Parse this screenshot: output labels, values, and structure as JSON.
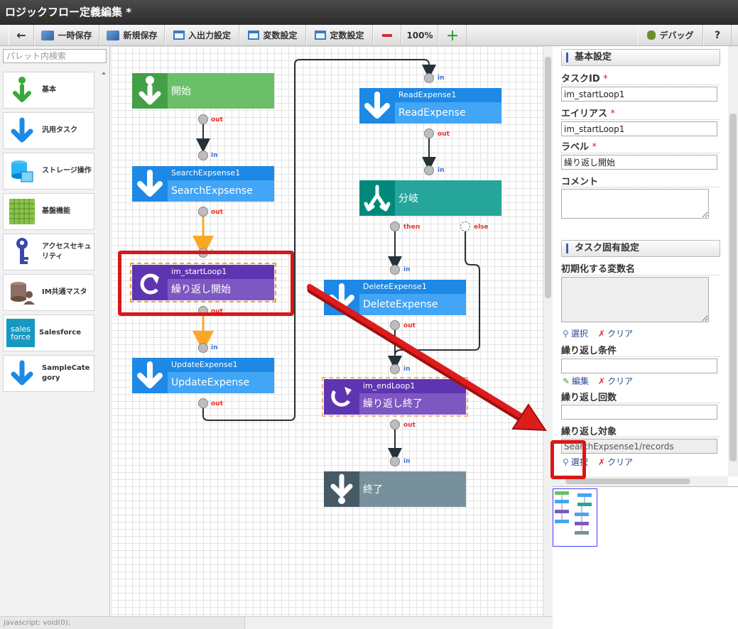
{
  "window": {
    "title": "ロジックフロー定義編集 *"
  },
  "toolbar": {
    "back_label": "←",
    "temp_save_label": "一時保存",
    "new_save_label": "新規保存",
    "io_settings_label": "入出力設定",
    "var_settings_label": "変数設定",
    "const_settings_label": "定数設定",
    "zoom_out_label": "−",
    "zoom_level": "100%",
    "zoom_in_label": "＋",
    "debug_label": "デバッグ",
    "help_label": "?"
  },
  "palette": {
    "search_placeholder": "パレット内検索",
    "items": [
      {
        "label": "基本",
        "icon": "green-down-arrow-icon"
      },
      {
        "label": "汎用タスク",
        "icon": "blue-down-arrow-icon"
      },
      {
        "label": "ストレージ操作",
        "icon": "storage-icon"
      },
      {
        "label": "基盤機能",
        "icon": "grid-icon"
      },
      {
        "label": "アクセスセキュリティ",
        "icon": "key-icon"
      },
      {
        "label": "IM共通マスタ",
        "icon": "database-user-icon"
      },
      {
        "label": "Salesforce",
        "icon": "salesforce-icon"
      },
      {
        "label": "SampleCategory",
        "icon": "blue-down-arrow-icon"
      }
    ],
    "salesforce_logo": "sales force"
  },
  "canvas": {
    "nodes": {
      "start": {
        "label": "開始",
        "color": "#6cbf69"
      },
      "search": {
        "id": "SearchExpsense1",
        "label": "SearchExpsense",
        "color": "#42a5f5"
      },
      "start_loop": {
        "id": "im_startLoop1",
        "label": "繰り返し開始",
        "color": "#7e57c2"
      },
      "update": {
        "id": "UpdateExpense1",
        "label": "UpdateExpense",
        "color": "#42a5f5"
      },
      "read": {
        "id": "ReadExpense1",
        "label": "ReadExpense",
        "color": "#42a5f5"
      },
      "branch": {
        "label": "分岐",
        "color": "#26a69a"
      },
      "delete": {
        "id": "DeleteExpense1",
        "label": "DeleteExpense",
        "color": "#42a5f5"
      },
      "end_loop": {
        "id": "im_endLoop1",
        "label": "繰り返し終了",
        "color": "#7e57c2"
      },
      "end": {
        "label": "終了",
        "color": "#78909c"
      }
    },
    "port_labels": {
      "in": "in",
      "out": "out",
      "then": "then",
      "else": "else"
    }
  },
  "status": {
    "text": "javascript: void(0);"
  },
  "properties": {
    "basic_header": "基本設定",
    "task_id_label": "タスクID",
    "task_id_value": "im_startLoop1",
    "alias_label": "エイリアス",
    "alias_value": "im_startLoop1",
    "label_label": "ラベル",
    "label_value": "繰り返し開始",
    "comment_label": "コメント",
    "comment_value": "",
    "required_mark": "*",
    "task_header": "タスク固有設定",
    "init_var_label": "初期化する変数名",
    "init_var_value": "",
    "select_label": "選択",
    "clear_label": "クリア",
    "loop_cond_label": "繰り返し条件",
    "loop_cond_value": "",
    "edit_label": "編集",
    "loop_count_label": "繰り返し回数",
    "loop_count_value": "",
    "loop_target_label": "繰り返し対象",
    "loop_target_value": "SearchExpsense1/records"
  },
  "colors": {
    "annotation": "#d81818",
    "title_bar": "#333333",
    "link": "#2a4b8d"
  }
}
